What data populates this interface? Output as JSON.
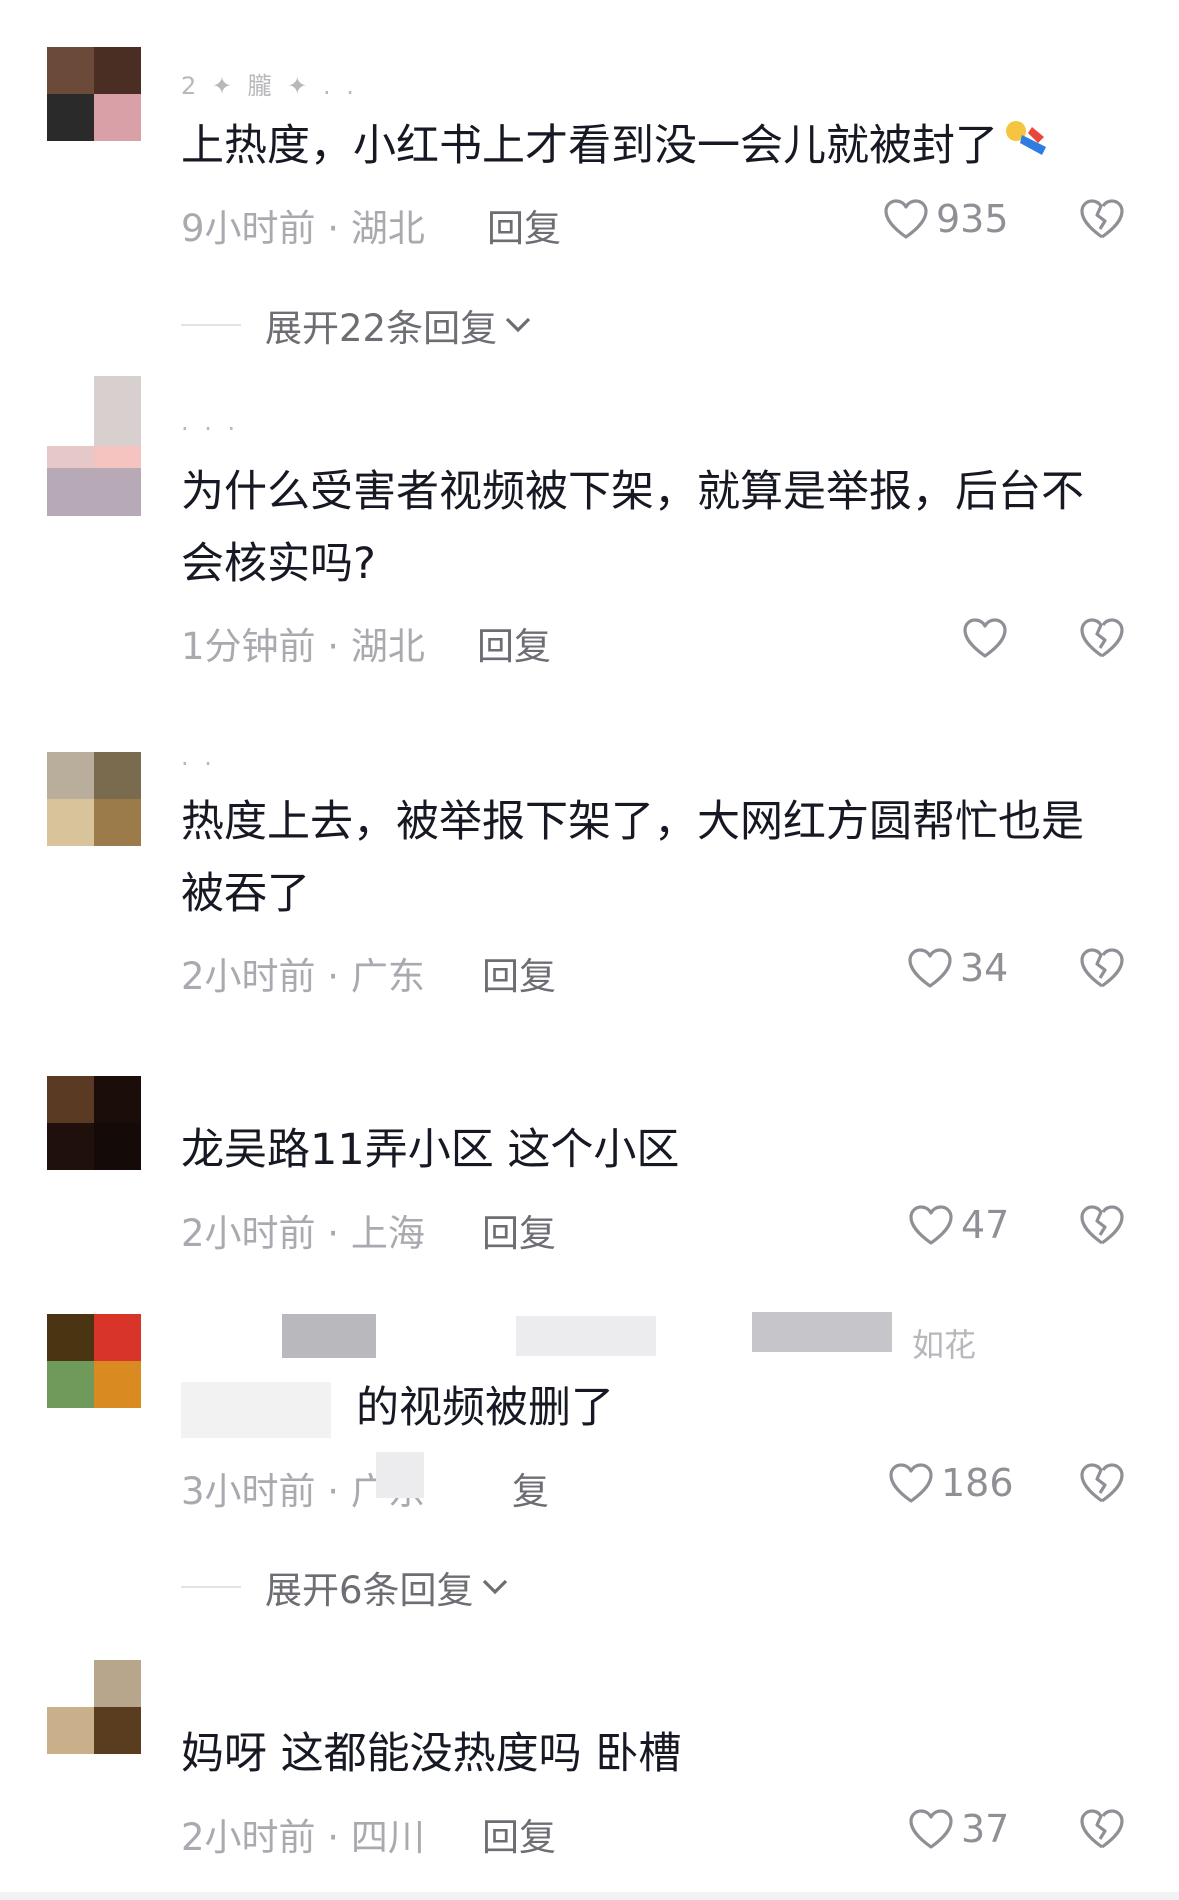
{
  "comments": [
    {
      "username": "2 ✦ 朧 ✦ . .",
      "text_lines": [
        "上热度，小红书上才看到没一会儿就被封了"
      ],
      "time": "9小时前 · 湖北",
      "reply_label": "回复",
      "likes": "935",
      "expand": "展开22条回复"
    },
    {
      "username": "·  ·  ·",
      "text_lines": [
        "为什么受害者视频被下架，就算是举报，后台不",
        "会核实吗?"
      ],
      "time": "1分钟前 · 湖北",
      "reply_label": "回复",
      "likes": ""
    },
    {
      "username": "· ·",
      "text_lines": [
        "热度上去，被举报下架了，大网红方圆帮忙也是",
        "被吞了"
      ],
      "time": "2小时前 · 广东",
      "reply_label": "回复",
      "likes": "34"
    },
    {
      "username": "",
      "text_lines": [
        "龙吴路11弄小区 这个小区"
      ],
      "time": "2小时前 · 上海",
      "reply_label": "回复",
      "likes": "47"
    },
    {
      "username": "如花",
      "text_lines": [
        "的视频被删了"
      ],
      "time": "3小时前 · 广东",
      "reply_label": "复",
      "likes": "186",
      "expand": "展开6条回复"
    },
    {
      "username": "",
      "text_lines": [
        "妈呀 这都能没热度吗 卧槽"
      ],
      "time": "2小时前 · 四川",
      "reply_label": "回复",
      "likes": "37"
    }
  ],
  "icons": {
    "like": "heart-outline-icon",
    "dislike": "broken-heart-icon",
    "expand": "chevron-down-icon"
  },
  "colors": {
    "text": "#161823",
    "meta": "#a9aab0",
    "secondary": "#6d6e74"
  }
}
